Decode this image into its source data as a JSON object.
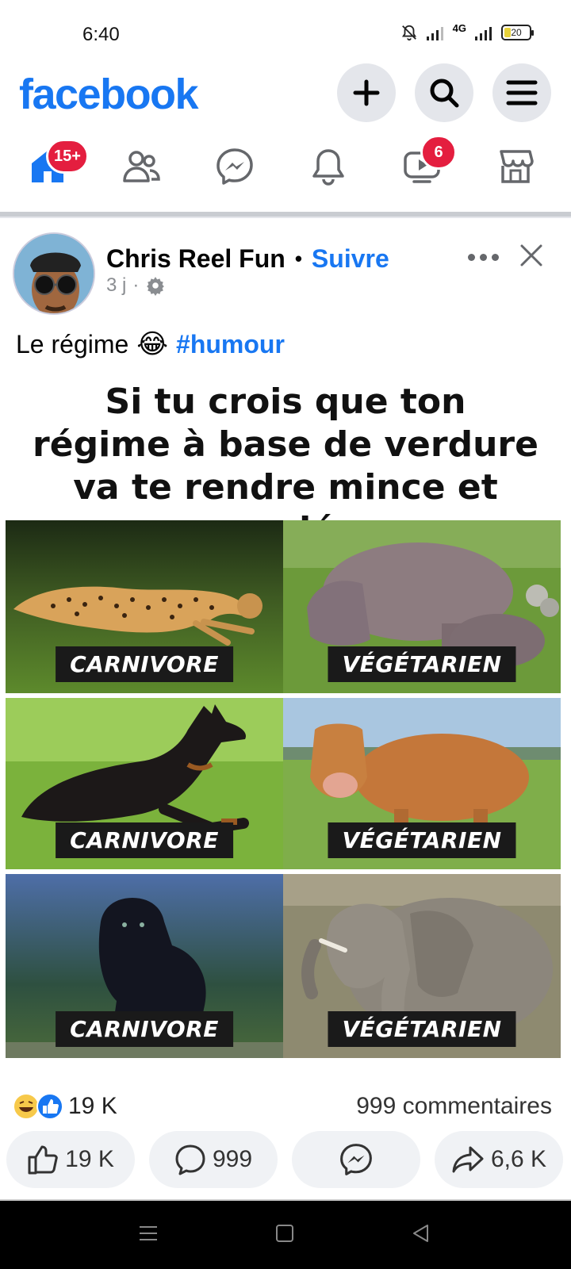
{
  "status": {
    "time": "6:40",
    "network": "4G",
    "battery": "20"
  },
  "header": {
    "logo": "facebook",
    "accent": "#1877f2"
  },
  "nav": {
    "home_badge": "15+",
    "video_badge": "6",
    "badge_color": "#e41e3f"
  },
  "post": {
    "author": "Chris Reel Fun",
    "dot": "•",
    "follow_label": "Suivre",
    "time": "3 j",
    "sep": "·",
    "caption_text": "Le régime",
    "caption_emoji": "😂",
    "hashtag": "#humour"
  },
  "meme": {
    "title": "Si tu crois que ton régime à base de verdure va te rendre mince et musclé...",
    "cells": [
      {
        "label": "CARNIVORE",
        "subject": "cheetah"
      },
      {
        "label": "VÉGÉTARIEN",
        "subject": "hippopotamus"
      },
      {
        "label": "CARNIVORE",
        "subject": "doberman"
      },
      {
        "label": "VÉGÉTARIEN",
        "subject": "cow"
      },
      {
        "label": "CARNIVORE",
        "subject": "black panther"
      },
      {
        "label": "VÉGÉTARIEN",
        "subject": "elephant"
      }
    ]
  },
  "stats": {
    "reactions": "19 K",
    "comments": "999 commentaires"
  },
  "actions": {
    "like_count": "19 K",
    "comment_count": "999",
    "share_count": "6,6 K"
  }
}
